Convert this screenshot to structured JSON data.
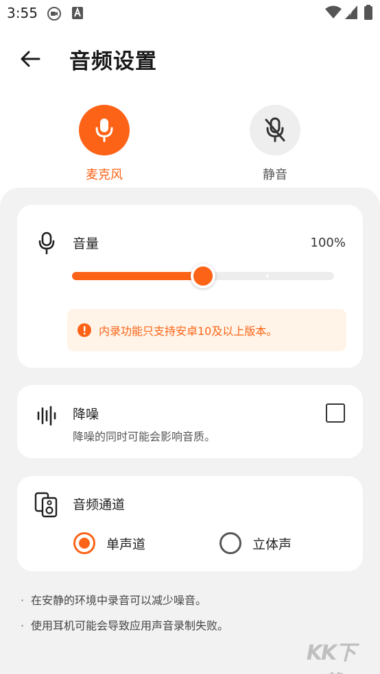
{
  "status_bar": {
    "time": "3:55",
    "icons": [
      "screen-record-icon",
      "text-a-icon",
      "wifi-icon",
      "signal-icon",
      "battery-icon"
    ]
  },
  "header": {
    "title": "音频设置",
    "back_icon": "back-arrow-icon"
  },
  "modes": [
    {
      "label": "麦克风",
      "icon": "mic-icon",
      "selected": true
    },
    {
      "label": "静音",
      "icon": "mic-off-icon",
      "selected": false
    }
  ],
  "volume": {
    "title": "音量",
    "value_text": "100%",
    "slider_level": 0.5,
    "notice": "内录功能只支持安卓10及以上版本。"
  },
  "noise": {
    "title": "降噪",
    "description": "降噪的同时可能会影响音质。",
    "checked": false
  },
  "channel": {
    "title": "音频通道",
    "options": [
      {
        "label": "单声道",
        "selected": true
      },
      {
        "label": "立体声",
        "selected": false
      }
    ]
  },
  "tips": [
    "在安静的环境中录音可以减少噪音。",
    "使用耳机可能会导致应用声音录制失败。"
  ],
  "colors": {
    "accent": "#fd6317",
    "notice_bg": "#fff4e7",
    "sheet_bg": "#f2f2f2"
  }
}
